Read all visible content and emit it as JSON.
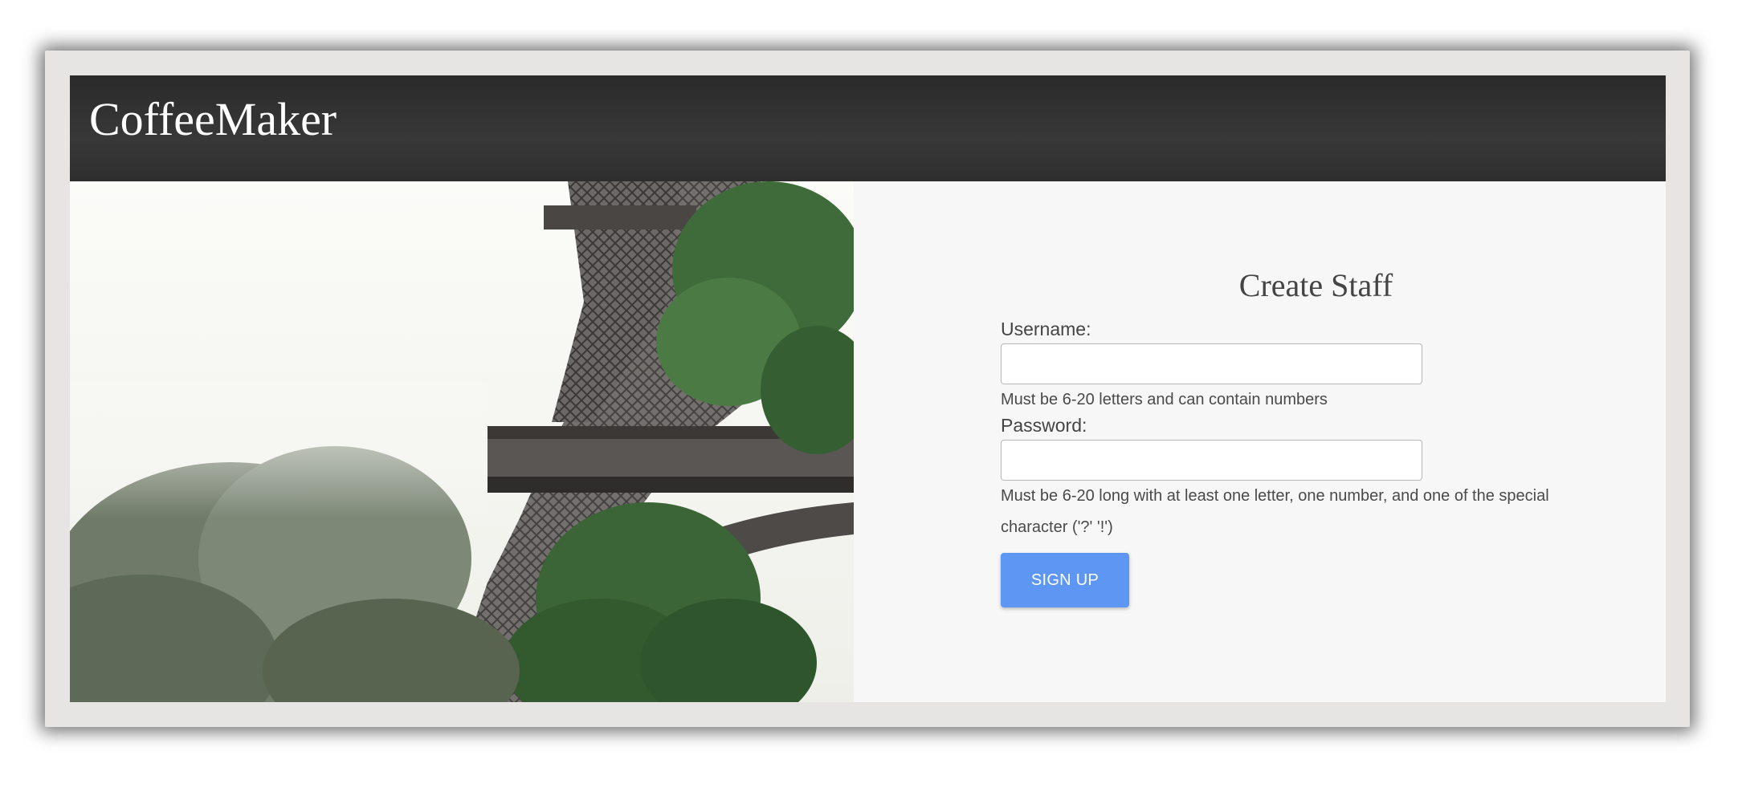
{
  "app": {
    "brand": "CoffeeMaker"
  },
  "form": {
    "title": "Create Staff",
    "username": {
      "label": "Username:",
      "value": "",
      "placeholder": "",
      "hint": "Must be 6-20 letters and can contain numbers"
    },
    "password": {
      "label": "Password:",
      "value": "",
      "placeholder": "",
      "hint": "Must be 6-20 long with at least one letter, one number, and one of the special character ('?' '!')"
    },
    "submit_label": "SIGN UP"
  },
  "colors": {
    "header": "#2f2f2f",
    "button": "#5d97f3",
    "panel": "#f7f7f7"
  },
  "image": {
    "subject": "eiffel-tower-with-trees-photo"
  }
}
